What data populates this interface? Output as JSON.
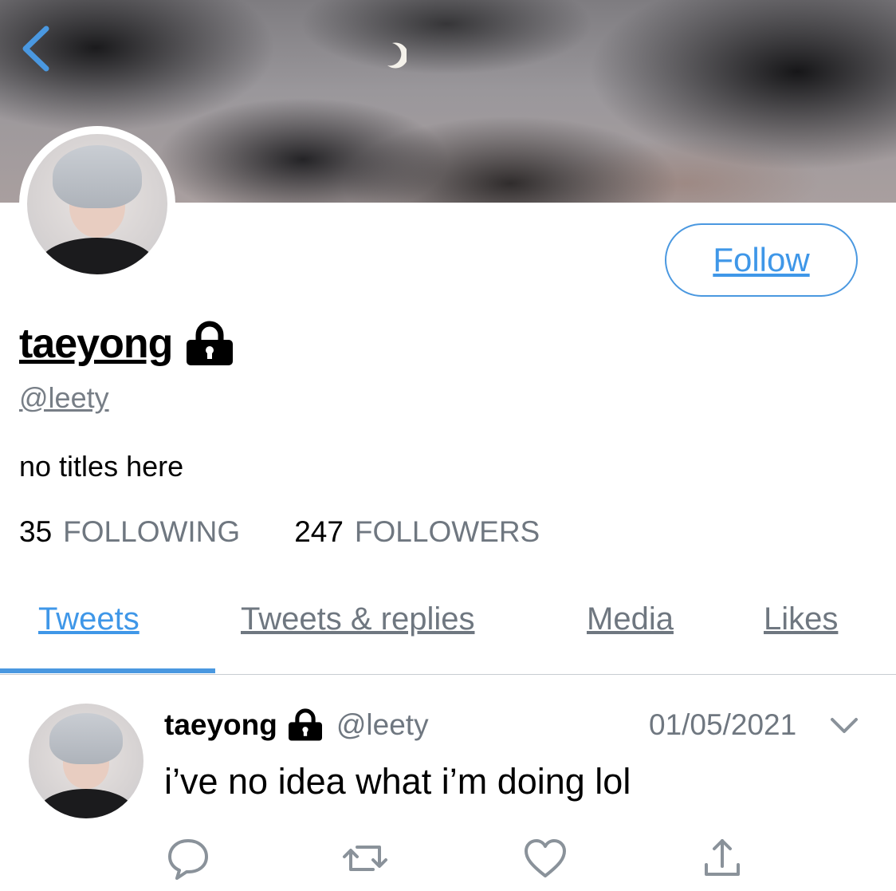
{
  "profile": {
    "display_name": "taeyong",
    "handle": "@leety",
    "bio": "no titles here",
    "follow_label": "Follow",
    "following_count": "35",
    "following_label": "FOLLOWING",
    "followers_count": "247",
    "followers_label": "FOLLOWERS"
  },
  "tabs": [
    {
      "label": "Tweets",
      "active": true
    },
    {
      "label": "Tweets & replies",
      "active": false
    },
    {
      "label": "Media",
      "active": false
    },
    {
      "label": "Likes",
      "active": false
    }
  ],
  "tweet": {
    "name": "taeyong",
    "handle": "@leety",
    "date": "01/05/2021",
    "text": "i’ve no idea what i’m doing lol"
  },
  "icons": [
    "back-chevron-icon",
    "lock-icon",
    "chevron-down-icon",
    "reply-icon",
    "retweet-icon",
    "heart-icon",
    "share-icon"
  ],
  "colors": {
    "accent": "#3f97e8",
    "muted": "#6f7780"
  }
}
